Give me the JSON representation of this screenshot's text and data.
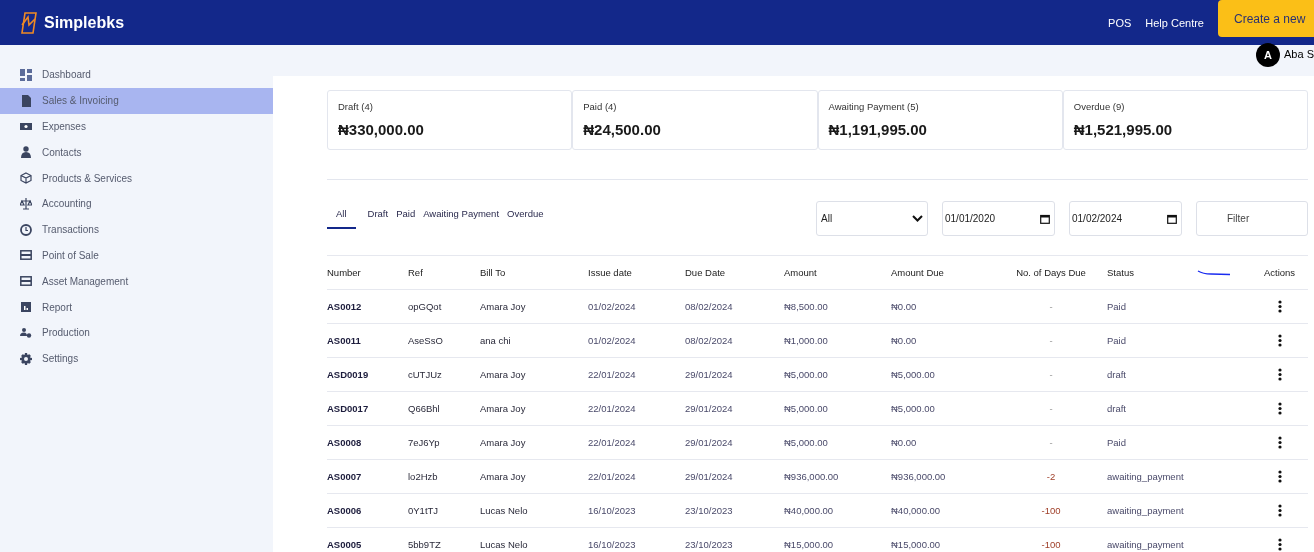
{
  "header": {
    "brand": "Simplebks",
    "links": [
      "POS",
      "Help Centre"
    ],
    "create_button": "Create a new"
  },
  "user": {
    "initial": "A",
    "name": "Aba S"
  },
  "sidebar": {
    "items": [
      {
        "label": "Dashboard",
        "selected": false
      },
      {
        "label": "Sales & Invoicing",
        "selected": true
      },
      {
        "label": "Expenses",
        "selected": false
      },
      {
        "label": "Contacts",
        "selected": false
      },
      {
        "label": "Products & Services",
        "selected": false
      },
      {
        "label": "Accounting",
        "selected": false
      },
      {
        "label": "Transactions",
        "selected": false
      },
      {
        "label": "Point of Sale",
        "selected": false
      },
      {
        "label": "Asset Management",
        "selected": false
      },
      {
        "label": "Report",
        "selected": false
      },
      {
        "label": "Production",
        "selected": false
      },
      {
        "label": "Settings",
        "selected": false
      }
    ]
  },
  "summary_cards": [
    {
      "label": "Draft (4)",
      "amount": "₦330,000.00"
    },
    {
      "label": "Paid (4)",
      "amount": "₦24,500.00"
    },
    {
      "label": "Awaiting Payment (5)",
      "amount": "₦1,191,995.00"
    },
    {
      "label": "Overdue (9)",
      "amount": "₦1,521,995.00"
    }
  ],
  "tabs": [
    {
      "label": "All",
      "selected": true
    },
    {
      "label": "Draft",
      "selected": false
    },
    {
      "label": "Paid",
      "selected": false
    },
    {
      "label": "Awaiting Payment",
      "selected": false
    },
    {
      "label": "Overdue",
      "selected": false
    }
  ],
  "filters": {
    "status": "All",
    "from_date": "01/01/2020",
    "to_date": "01/02/2024",
    "button": "Filter"
  },
  "table": {
    "columns": [
      "Number",
      "Ref",
      "Bill To",
      "Issue date",
      "Due Date",
      "Amount",
      "Amount Due",
      "No. of Days Due",
      "Status",
      "Actions"
    ],
    "rows": [
      {
        "number": "AS0012",
        "ref": "opGQot",
        "bill_to": "Amara Joy",
        "issue_date": "01/02/2024",
        "due_date": "08/02/2024",
        "amount": "₦8,500.00",
        "amount_due": "₦0.00",
        "days_due": "-",
        "overdue": false,
        "status": "Paid"
      },
      {
        "number": "AS0011",
        "ref": "AseSsO",
        "bill_to": "ana chi",
        "issue_date": "01/02/2024",
        "due_date": "08/02/2024",
        "amount": "₦1,000.00",
        "amount_due": "₦0.00",
        "days_due": "-",
        "overdue": false,
        "status": "Paid"
      },
      {
        "number": "ASD0019",
        "ref": "cUTJUz",
        "bill_to": "Amara Joy",
        "issue_date": "22/01/2024",
        "due_date": "29/01/2024",
        "amount": "₦5,000.00",
        "amount_due": "₦5,000.00",
        "days_due": "-",
        "overdue": false,
        "status": "draft"
      },
      {
        "number": "ASD0017",
        "ref": "Q66Bhl",
        "bill_to": "Amara Joy",
        "issue_date": "22/01/2024",
        "due_date": "29/01/2024",
        "amount": "₦5,000.00",
        "amount_due": "₦5,000.00",
        "days_due": "-",
        "overdue": false,
        "status": "draft"
      },
      {
        "number": "AS0008",
        "ref": "7eJ6Yp",
        "bill_to": "Amara Joy",
        "issue_date": "22/01/2024",
        "due_date": "29/01/2024",
        "amount": "₦5,000.00",
        "amount_due": "₦0.00",
        "days_due": "-",
        "overdue": false,
        "status": "Paid"
      },
      {
        "number": "AS0007",
        "ref": "lo2Hzb",
        "bill_to": "Amara Joy",
        "issue_date": "22/01/2024",
        "due_date": "29/01/2024",
        "amount": "₦936,000.00",
        "amount_due": "₦936,000.00",
        "days_due": "-2",
        "overdue": true,
        "status": "awaiting_payment"
      },
      {
        "number": "AS0006",
        "ref": "0Y1tTJ",
        "bill_to": "Lucas Nelo",
        "issue_date": "16/10/2023",
        "due_date": "23/10/2023",
        "amount": "₦40,000.00",
        "amount_due": "₦40,000.00",
        "days_due": "-100",
        "overdue": true,
        "status": "awaiting_payment"
      },
      {
        "number": "AS0005",
        "ref": "5bb9TZ",
        "bill_to": "Lucas Nelo",
        "issue_date": "16/10/2023",
        "due_date": "23/10/2023",
        "amount": "₦15,000.00",
        "amount_due": "₦15,000.00",
        "days_due": "-100",
        "overdue": true,
        "status": "awaiting_payment"
      }
    ]
  }
}
